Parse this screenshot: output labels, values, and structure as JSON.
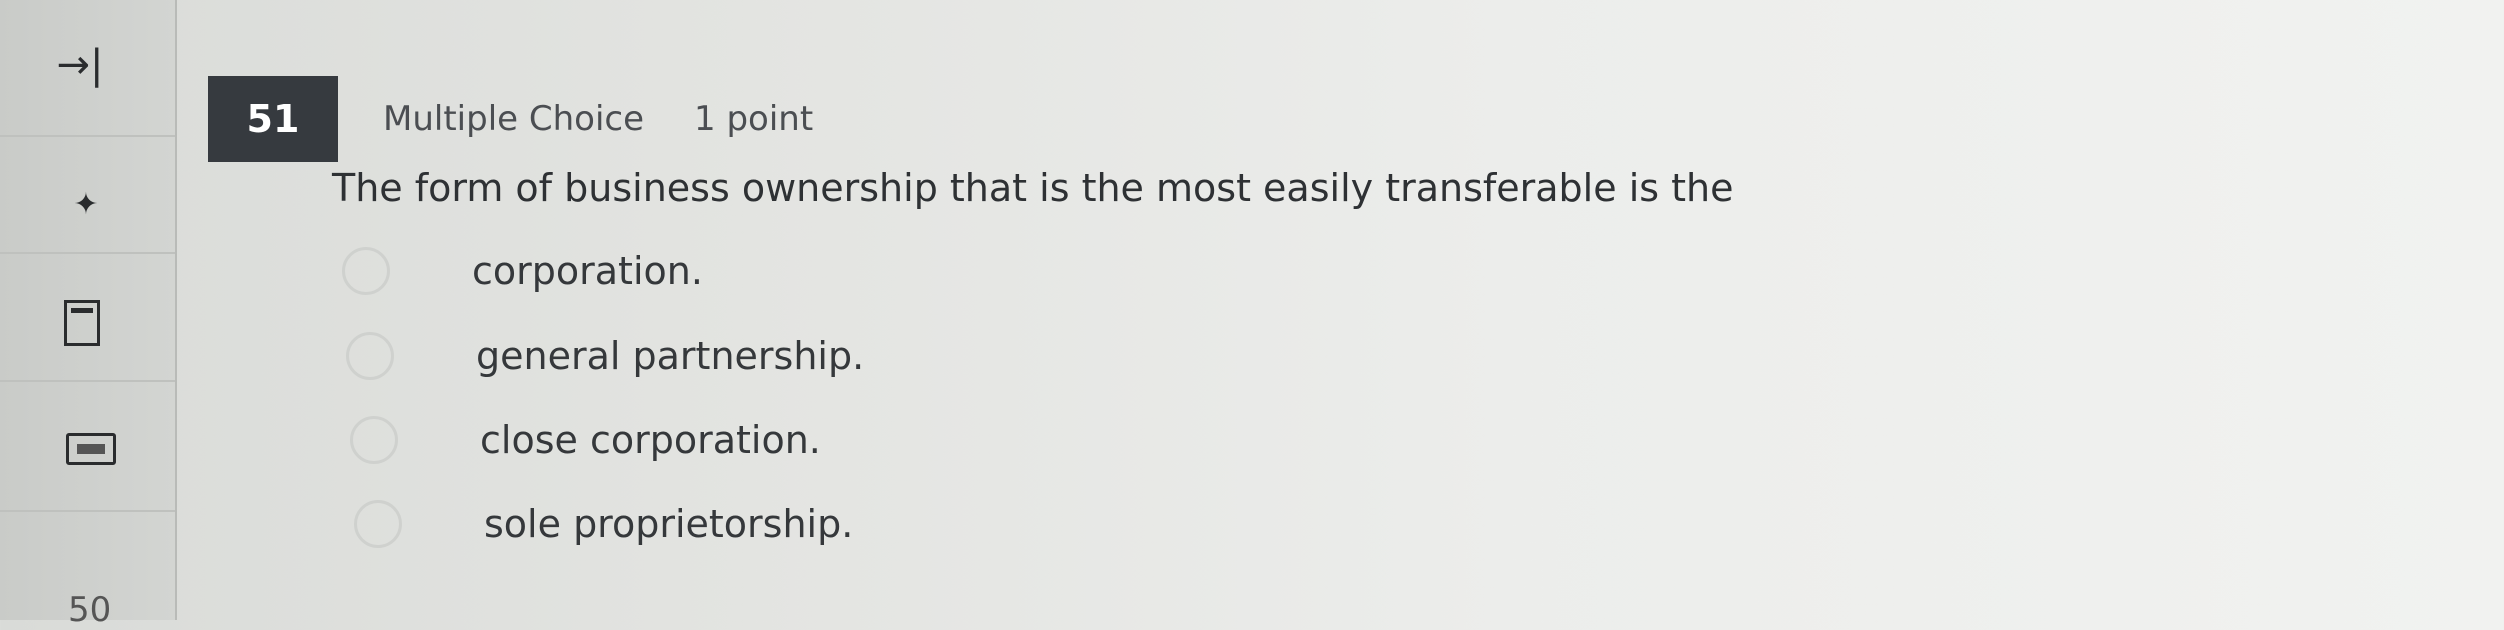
{
  "sidebar": {
    "collapse_icon": "arrow-right-to-bar-icon",
    "pin_icon": "pin-icon",
    "bookmark_icon": "bookmark-icon",
    "calculator_icon": "calculator-icon",
    "previous_question_number": "50"
  },
  "question": {
    "number": "51",
    "type": "Multiple Choice",
    "points": "1 point",
    "prompt": "The form of business ownership that is the most easily transferable is the",
    "options": [
      {
        "label": "corporation."
      },
      {
        "label": "general partnership."
      },
      {
        "label": "close corporation."
      },
      {
        "label": "sole proprietorship."
      }
    ]
  },
  "colors": {
    "question_number_bg": "#363a3f",
    "question_number_text": "#ffffff",
    "sidebar_bg": "#cfd1ce"
  }
}
